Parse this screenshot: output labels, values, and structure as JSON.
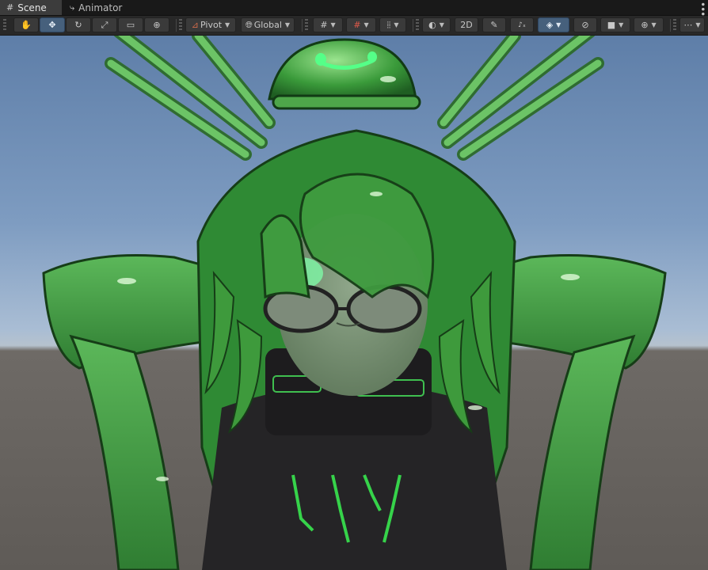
{
  "tabs": [
    {
      "label": "Scene",
      "icon": "grid-icon",
      "active": true
    },
    {
      "label": "Animator",
      "icon": "animator-icon",
      "active": false
    }
  ],
  "toolbar": {
    "pivot_label": "Pivot",
    "global_label": "Global",
    "mode_2d_label": "2D",
    "tools": [
      "hand-tool",
      "move-tool",
      "rotate-tool",
      "scale-tool",
      "rect-tool",
      "transform-tool"
    ],
    "active_tool": "move-tool",
    "active_color": "#46607c"
  },
  "scene": {
    "sky_top": "#5e7ea8",
    "horizon": "#b6c2ce",
    "ground": "#5f5b57",
    "slime_green": "#3f9b3f",
    "accent_glow": "#39ff6a"
  }
}
